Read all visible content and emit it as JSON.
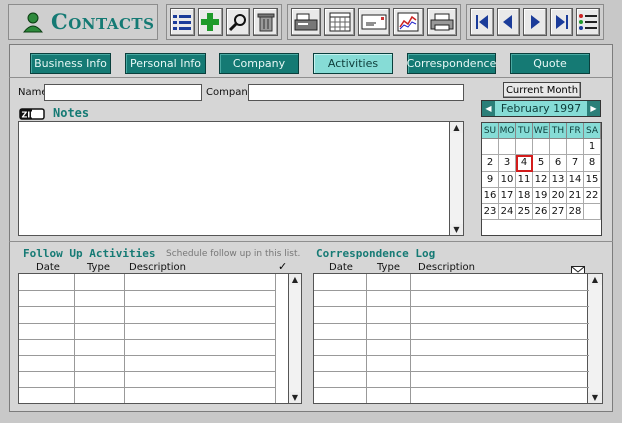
{
  "app": {
    "title": "Contacts",
    "icon": "person-icon"
  },
  "toolbar": {
    "group1": [
      "list-view-icon",
      "add-icon",
      "find-icon",
      "trash-icon"
    ],
    "group2": [
      "fax-icon",
      "calendar-icon",
      "envelope-icon",
      "report-icon",
      "print-icon"
    ],
    "group3": [
      "first-record-icon",
      "previous-record-icon",
      "next-record-icon",
      "last-record-icon",
      "menu-list-icon"
    ]
  },
  "tabs": [
    "Business Info",
    "Personal Info",
    "Company",
    "Activities",
    "Correspondence",
    "Quote"
  ],
  "active_tab": "Activities",
  "form": {
    "name_label": "Name",
    "name_value": "",
    "company_label": "Company",
    "company_value": "",
    "notes_label": "Notes",
    "notes_value": ""
  },
  "calendar": {
    "button_label": "Current Month",
    "month_label": "February 1997",
    "day_headers": [
      "SU",
      "MO",
      "TU",
      "WE",
      "TH",
      "FR",
      "SA"
    ],
    "days": [
      "",
      "",
      "",
      "",
      "",
      "",
      "1",
      "2",
      "3",
      "4",
      "5",
      "6",
      "7",
      "8",
      "9",
      "10",
      "11",
      "12",
      "13",
      "14",
      "15",
      "16",
      "17",
      "18",
      "19",
      "20",
      "21",
      "22",
      "23",
      "24",
      "25",
      "26",
      "27",
      "28",
      ""
    ],
    "today": "4",
    "highlight_color": "#d31c1c"
  },
  "followup": {
    "title": "Follow Up Activities",
    "hint": "Schedule follow up in this list.",
    "columns": [
      "Date",
      "Type",
      "Description"
    ],
    "check_symbol": "✓"
  },
  "correspondence": {
    "title": "Correspondence Log",
    "columns": [
      "Date",
      "Type",
      "Description"
    ]
  },
  "colors": {
    "accent": "#157a74",
    "active_tab": "#86dcd6",
    "background": "#c8c8c8"
  }
}
